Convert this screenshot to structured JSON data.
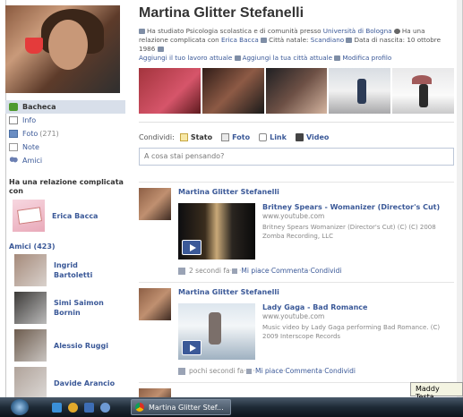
{
  "profile": {
    "name": "Martina Glitter Stefanelli",
    "info_prefix": "Ha studiato Psicologia scolastica e di comunità presso",
    "university": "Università di Bologna",
    "relationship_prefix": "Ha una relazione complicata con",
    "relationship_partner": "Erica Bacca",
    "hometown_label": "Città natale:",
    "hometown": "Scandiano",
    "birth_label": "Data di nascita:",
    "birth_date": "10 ottobre 1986",
    "add_work": "Aggiungi il tuo lavoro attuale",
    "add_city": "Aggiungi la tua città attuale",
    "edit_profile": "Modifica profilo"
  },
  "nav": {
    "items": [
      {
        "label": "Bacheca",
        "icon": "wall-icon"
      },
      {
        "label": "Info",
        "icon": "info-icon"
      },
      {
        "label": "Foto",
        "count": "(271)",
        "icon": "photos-icon"
      },
      {
        "label": "Note",
        "icon": "notes-icon"
      },
      {
        "label": "Amici",
        "icon": "friends-icon"
      }
    ]
  },
  "relationship_section": {
    "title": "Ha una relazione complicata con",
    "name": "Erica Bacca"
  },
  "friends_section": {
    "title": "Amici (423)",
    "friends": [
      {
        "name": "Ingrid Bartoletti",
        "color": "#a58a7a"
      },
      {
        "name": "Simi Saimon Bornin",
        "color": "#3c3a38"
      },
      {
        "name": "Alessio Ruggi",
        "color": "#6d5c4e"
      },
      {
        "name": "Davide Arancio",
        "color": "#b0a39a"
      }
    ]
  },
  "share": {
    "label": "Condividi:",
    "options": [
      {
        "label": "Stato",
        "icon": "status-icon"
      },
      {
        "label": "Foto",
        "icon": "photo-icon"
      },
      {
        "label": "Link",
        "icon": "link-icon"
      },
      {
        "label": "Video",
        "icon": "video-icon"
      }
    ],
    "placeholder": "A cosa stai pensando?"
  },
  "posts": [
    {
      "author": "Martina Glitter Stefanelli",
      "video_title": "Britney Spears - Womanizer (Director's Cut)",
      "url": "www.youtube.com",
      "desc": "Britney Spears Womanizer (Director's Cut) (C) (C) 2008 Zomba Recording, LLC",
      "time": "2 secondi fa",
      "like": "Mi piace",
      "comment": "Commenta",
      "share": "Condividi"
    },
    {
      "author": "Martina Glitter Stefanelli",
      "video_title": "Lady Gaga - Bad Romance",
      "url": "www.youtube.com",
      "desc": "Music video by Lady Gaga performing Bad Romance. (C) 2009 Interscope Records",
      "time": "pochi secondi fa",
      "like": "Mi piace",
      "comment": "Commenta",
      "share": "Condividi"
    }
  ],
  "taskbar": {
    "task_label": "Martina Glitter Stef...",
    "tooltip": "Maddy Testa"
  },
  "sep": " · "
}
